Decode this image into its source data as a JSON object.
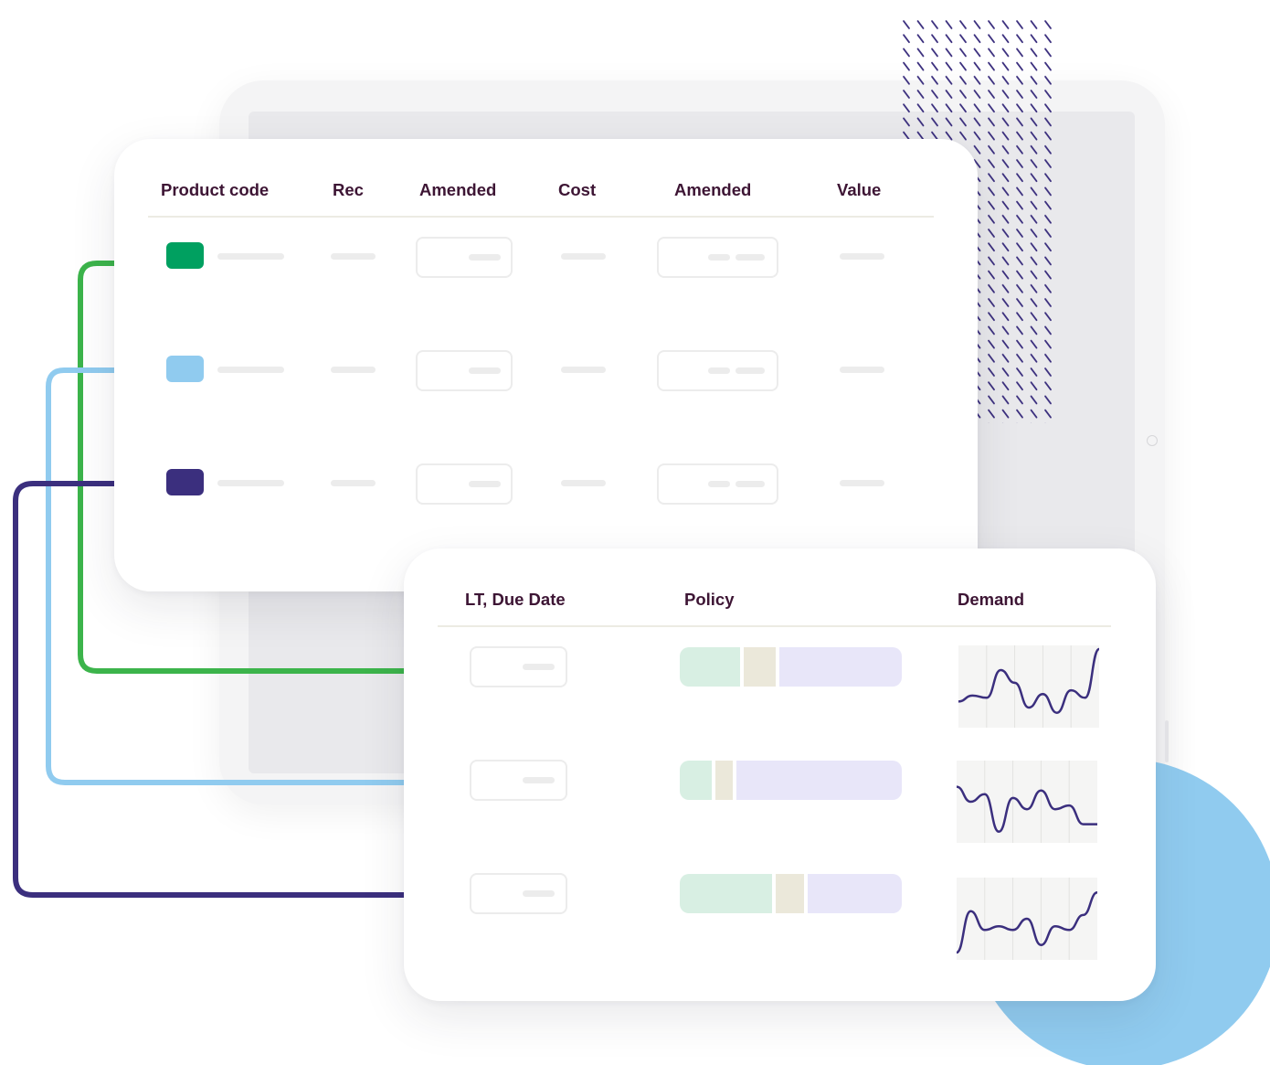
{
  "colors": {
    "green": "#00a060",
    "light_blue": "#90cbef",
    "navy": "#3b2f7e",
    "header_text": "#3d1534",
    "line_green": "#3cb44b",
    "line_blue": "#90cbef",
    "line_navy": "#3b2f7e"
  },
  "top_table": {
    "headers": {
      "product_code": "Product code",
      "rec": "Rec",
      "amended_1": "Amended",
      "cost": "Cost",
      "amended_2": "Amended",
      "value": "Value"
    },
    "rows": [
      {
        "swatch": "green"
      },
      {
        "swatch": "light_blue"
      },
      {
        "swatch": "navy"
      }
    ]
  },
  "bottom_table": {
    "headers": {
      "lt_due_date": "LT, Due Date",
      "policy": "Policy",
      "demand": "Demand"
    },
    "rows": [
      {
        "policy_split": [
          0.28,
          0.15,
          0.57
        ],
        "demand": [
          0.3,
          0.38,
          0.35,
          0.72,
          0.55,
          0.22,
          0.4,
          0.15,
          0.45,
          0.35,
          1.0
        ]
      },
      {
        "policy_split": [
          0.15,
          0.08,
          0.77
        ],
        "demand": [
          0.7,
          0.5,
          0.6,
          0.1,
          0.55,
          0.4,
          0.65,
          0.4,
          0.45,
          0.2,
          0.2
        ]
      },
      {
        "policy_split": [
          0.43,
          0.13,
          0.44
        ],
        "demand": [
          0.05,
          0.6,
          0.35,
          0.4,
          0.35,
          0.5,
          0.15,
          0.4,
          0.35,
          0.55,
          0.85
        ]
      }
    ]
  }
}
